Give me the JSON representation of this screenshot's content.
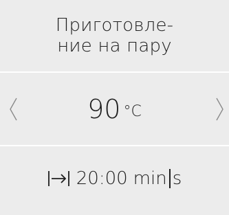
{
  "header": {
    "title_line1": "Приготовле-",
    "title_line2": "ние на пару"
  },
  "temperature": {
    "value": "90",
    "unit": "°C",
    "prev_icon": "chevron-left-icon",
    "next_icon": "chevron-right-icon"
  },
  "duration": {
    "icon": "duration-icon",
    "value": "20:00",
    "unit_minutes": "min",
    "unit_seconds": "s"
  },
  "colors": {
    "background": "#ececec",
    "divider": "#ffffff",
    "text": "#1e1e1e"
  }
}
